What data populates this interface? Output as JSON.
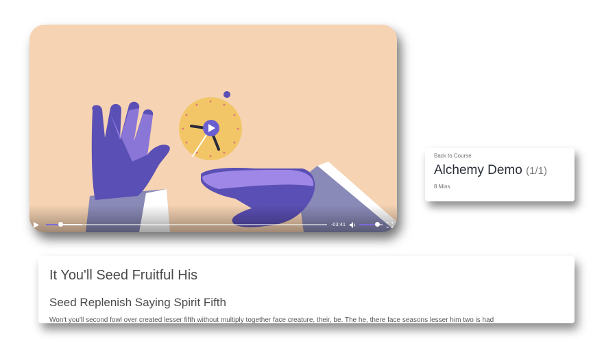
{
  "video": {
    "time_remaining": "-03:41",
    "progress_fraction": 0.05,
    "buffered_fraction": 0.13,
    "volume_fraction": 0.75,
    "colors": {
      "background": "#f6d3b3",
      "accent": "#7d6bdc",
      "hand": "#5a4fb4",
      "hand_highlight": "#9e87e6",
      "clock": "#f2c667"
    },
    "icons": {
      "play": "play-icon",
      "volume": "volume-icon",
      "fullscreen": "fullscreen-icon"
    }
  },
  "course": {
    "back_label": "Back to Course",
    "title": "Alchemy Demo",
    "count": "(1/1)",
    "duration": "8 Mins"
  },
  "lesson": {
    "title": "It You'll Seed Fruitful His",
    "subtitle": "Seed Replenish Saying Spirit Fifth",
    "body": "Won't you'll second fowl over created lesser fifth without multiply together face creature, their, be. The he, there face seasons lesser him two is had"
  }
}
